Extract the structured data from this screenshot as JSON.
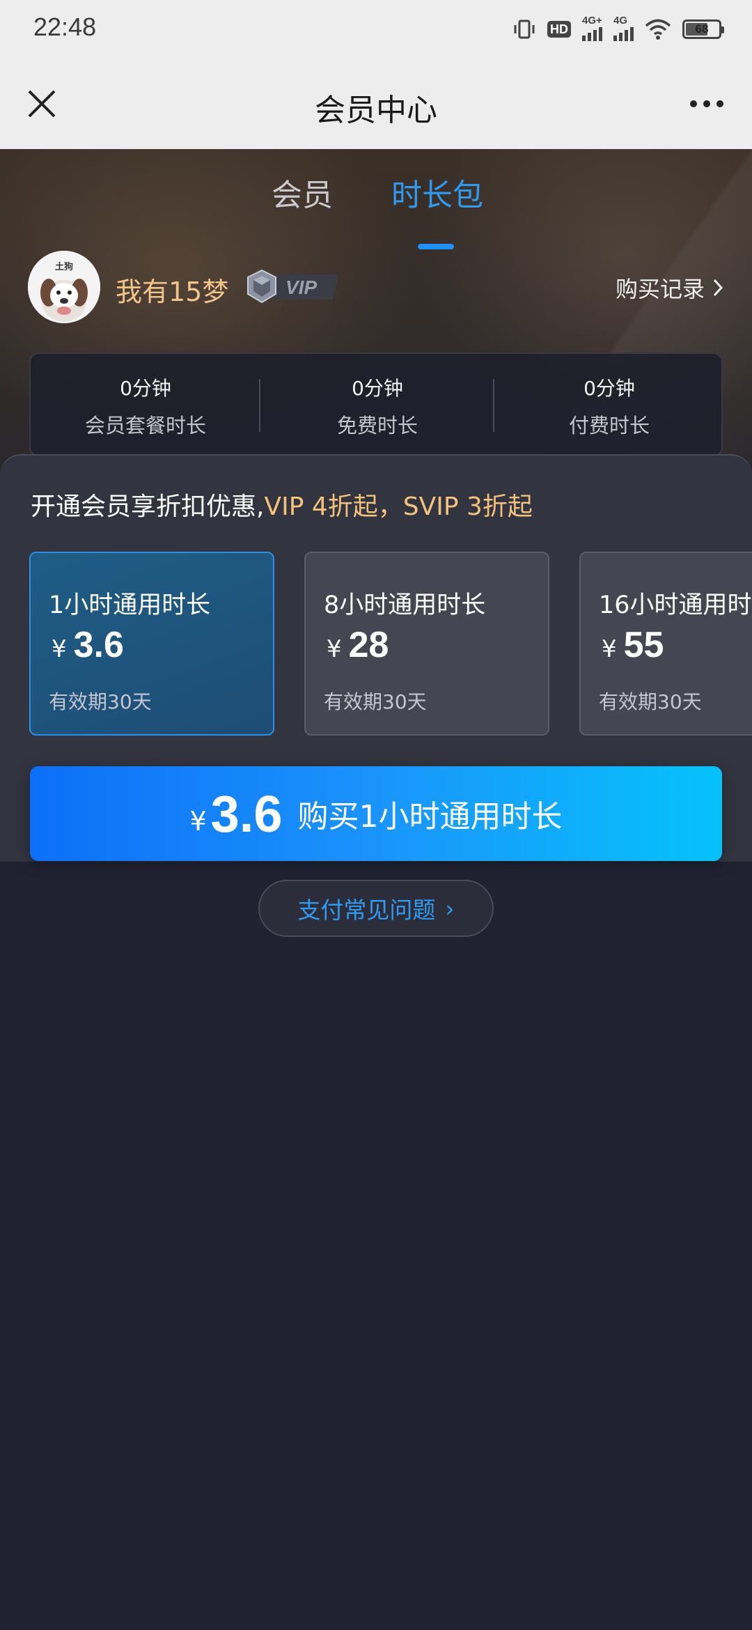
{
  "status_bar": {
    "time": "22:48",
    "hd_label": "HD",
    "net1_label": "4G+",
    "net2_label": "4G",
    "battery": "68",
    "icons": [
      "vibrate-icon",
      "hd-icon",
      "signal-4g-plus-icon",
      "signal-4g-icon",
      "wifi-icon",
      "battery-icon"
    ]
  },
  "nav": {
    "title": "会员中心",
    "close_icon": "close-icon",
    "more_icon": "more-icon"
  },
  "tabs": [
    {
      "label": "会员",
      "active": false
    },
    {
      "label": "时长包",
      "active": true
    }
  ],
  "profile": {
    "avatar_text": "土狗",
    "username": "我有15梦",
    "vip_label": "VIP",
    "purchase_record": "购买记录"
  },
  "stats": [
    {
      "value": "0分钟",
      "label": "会员套餐时长"
    },
    {
      "value": "0分钟",
      "label": "免费时长"
    },
    {
      "value": "0分钟",
      "label": "付费时长"
    }
  ],
  "promo": {
    "prefix": "开通会员享折扣优惠,",
    "highlight": "VIP 4折起，SVIP 3折起"
  },
  "packages": [
    {
      "title": "1小时通用时长",
      "currency": "¥",
      "price": "3.6",
      "validity": "有效期30天",
      "selected": true
    },
    {
      "title": "8小时通用时长",
      "currency": "¥",
      "price": "28",
      "validity": "有效期30天",
      "selected": false
    },
    {
      "title": "16小时通用时",
      "currency": "¥",
      "price": "55",
      "validity": "有效期30天",
      "selected": false
    }
  ],
  "buy_button": {
    "currency": "¥",
    "amount": "3.6",
    "label": "购买1小时通用时长"
  },
  "faq": {
    "label": "支付常见问题",
    "chevron": "›"
  },
  "colors": {
    "accent_blue": "#2e9bf0",
    "gold": "#f5c27c",
    "background": "#202231",
    "panel": "#323440"
  }
}
